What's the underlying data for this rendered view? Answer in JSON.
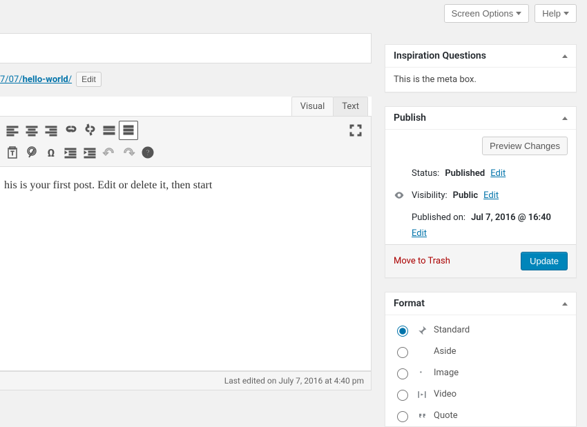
{
  "top": {
    "screen_options": "Screen Options",
    "help": "Help"
  },
  "permalink": {
    "path": "7/07/",
    "slug": "hello-world",
    "trail": "/",
    "edit": "Edit"
  },
  "editor": {
    "tabs": {
      "visual": "Visual",
      "text": "Text"
    },
    "content": "his is your first post. Edit or delete it, then start",
    "footer": "Last edited on July 7, 2016 at 4:40 pm"
  },
  "meta_inspiration": {
    "title": "Inspiration Questions",
    "body": "This is the meta box."
  },
  "publish": {
    "title": "Publish",
    "preview": "Preview Changes",
    "status_label": "Status:",
    "status_value": "Published",
    "visibility_label": "Visibility:",
    "visibility_value": "Public",
    "published_label": "Published on:",
    "published_value": "Jul 7, 2016 @ 16:40",
    "edit": "Edit",
    "trash": "Move to Trash",
    "update": "Update"
  },
  "format": {
    "title": "Format",
    "items": [
      {
        "label": "Standard",
        "selected": true
      },
      {
        "label": "Aside",
        "selected": false
      },
      {
        "label": "Image",
        "selected": false
      },
      {
        "label": "Video",
        "selected": false
      },
      {
        "label": "Quote",
        "selected": false
      }
    ]
  }
}
